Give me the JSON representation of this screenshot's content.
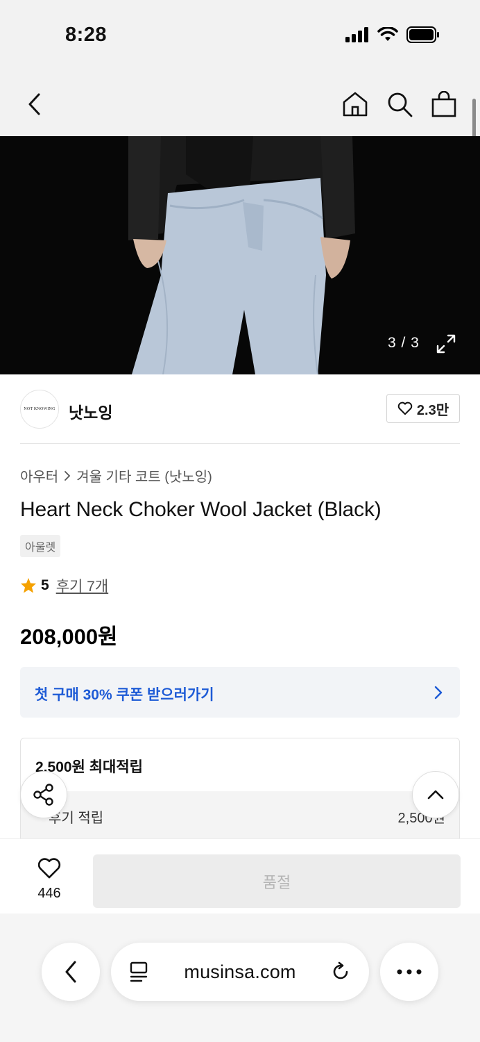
{
  "status_bar": {
    "time": "8:28"
  },
  "header": {
    "back": "back",
    "home": "home",
    "search": "search",
    "cart": "cart"
  },
  "gallery": {
    "counter": "3 / 3"
  },
  "brand": {
    "logo_text": "NOT KNOWING",
    "name": "낫노잉",
    "like_count": "2.3만"
  },
  "breadcrumb": {
    "category": "아우터",
    "subcategory": "겨울 기타 코트 (낫노잉)"
  },
  "product": {
    "title": "Heart Neck Choker Wool Jacket (Black)",
    "tag": "아울렛",
    "rating_score": "5",
    "review_link": "후기 7개",
    "price": "208,000원"
  },
  "coupon": {
    "text": "첫 구매 30% 쿠폰 받으러가기"
  },
  "points": {
    "title": "2,500원 최대적립",
    "row_label": "후기 적립",
    "row_value": "2,500원"
  },
  "bottom_bar": {
    "wish_count": "446",
    "soldout_label": "품절"
  },
  "browser": {
    "url": "musinsa.com"
  },
  "colors": {
    "accent_blue": "#1e5bd6",
    "star": "#f5a100"
  }
}
